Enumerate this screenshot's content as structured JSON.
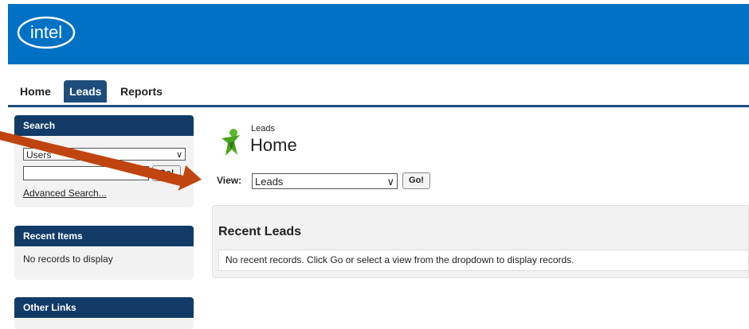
{
  "brand": {
    "logo_text": "intel",
    "header_color": "#0071c5"
  },
  "tabs": [
    {
      "label": "Home"
    },
    {
      "label": "Leads"
    },
    {
      "label": "Reports"
    }
  ],
  "sidebar": {
    "search": {
      "title": "Search",
      "scope_value": "Users",
      "query_value": "",
      "go_label": "Go!",
      "advanced_link": "Advanced Search..."
    },
    "recent_items": {
      "title": "Recent Items",
      "empty_text": "No records to display"
    },
    "other_links": {
      "title": "Other Links"
    }
  },
  "main": {
    "breadcrumb": "Leads",
    "title": "Home",
    "view": {
      "label": "View:",
      "value": "Leads",
      "go_label": "Go!"
    },
    "recent": {
      "title": "Recent Leads",
      "message": "No recent records. Click Go or select a view from the dropdown to display records."
    }
  },
  "colors": {
    "tab_active": "#1e4d7b",
    "panel_header": "#123b67",
    "annotation_arrow": "#c0440f"
  }
}
